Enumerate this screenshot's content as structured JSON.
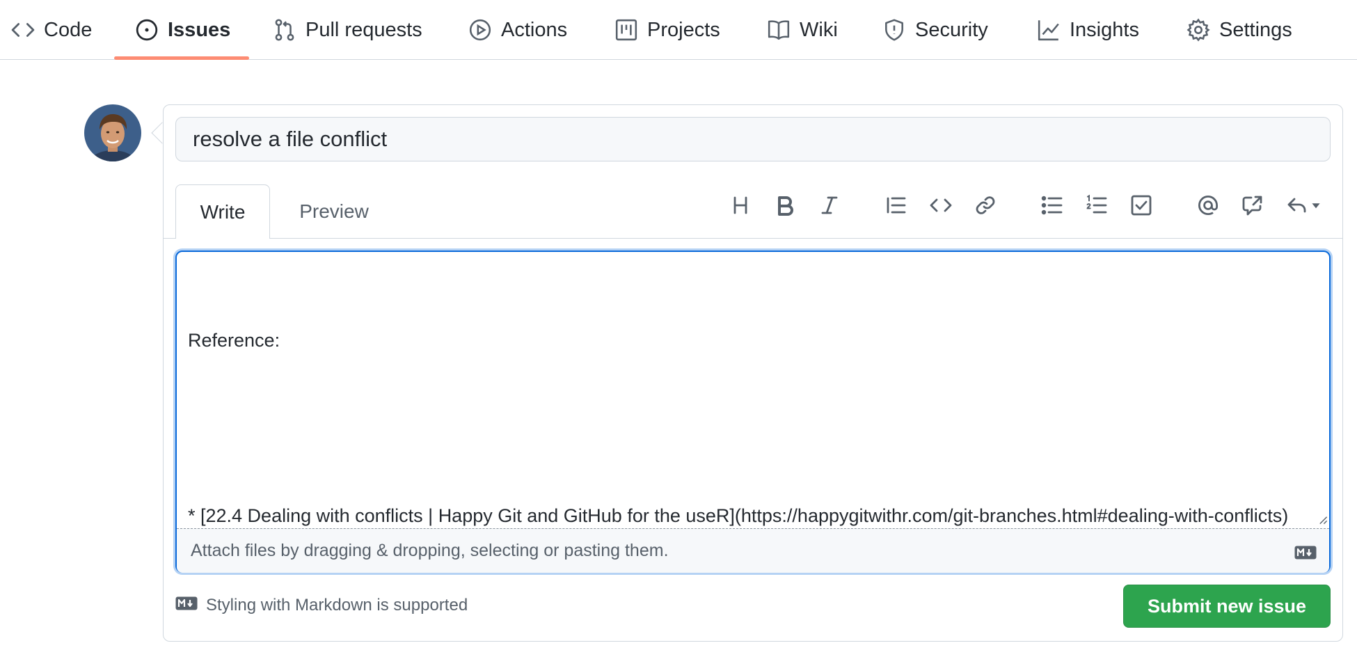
{
  "nav": {
    "tabs": [
      {
        "label": "Code",
        "icon": "code-icon"
      },
      {
        "label": "Issues",
        "icon": "issue-opened-icon",
        "active": true
      },
      {
        "label": "Pull requests",
        "icon": "git-pull-request-icon"
      },
      {
        "label": "Actions",
        "icon": "play-icon"
      },
      {
        "label": "Projects",
        "icon": "project-icon"
      },
      {
        "label": "Wiki",
        "icon": "book-icon"
      },
      {
        "label": "Security",
        "icon": "shield-icon"
      },
      {
        "label": "Insights",
        "icon": "graph-icon"
      },
      {
        "label": "Settings",
        "icon": "gear-icon"
      }
    ],
    "active_color": "#fd8c73"
  },
  "form": {
    "title_value": "resolve a file conflict",
    "tabs": {
      "write": "Write",
      "preview": "Preview"
    },
    "toolbar": [
      "heading-icon",
      "bold-icon",
      "italic-icon",
      "quote-icon",
      "code-icon",
      "link-icon",
      "unordered-list-icon",
      "ordered-list-icon",
      "tasklist-icon",
      "mention-icon",
      "cross-reference-icon",
      "reply-icon"
    ],
    "body_lines": [
      "Reference:",
      "",
      "* [22.4 Dealing with conflicts | Happy Git and GitHub for the useR](https://happygitwithr.com/git-branches.html#dealing-with-conflicts)"
    ],
    "attach_text": "Attach files by dragging & dropping, selecting or pasting them.",
    "markdown_note": "Styling with Markdown is supported",
    "submit_label": "Submit new issue",
    "submit_color": "#2da44e",
    "focus_color": "#0969da"
  }
}
